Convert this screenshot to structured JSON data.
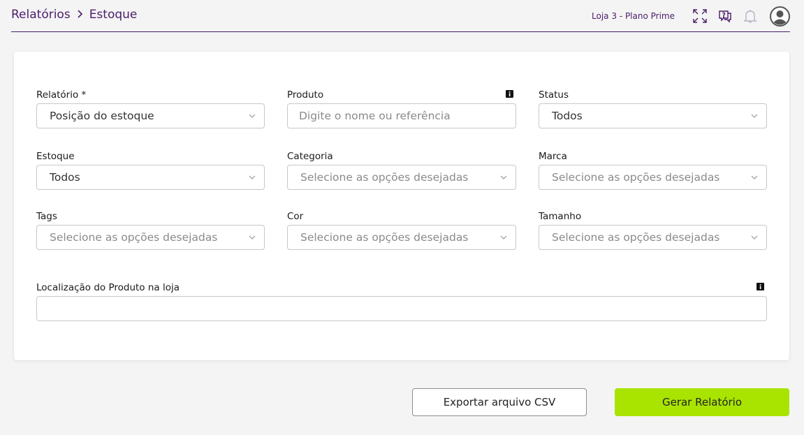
{
  "header": {
    "breadcrumb": [
      "Relatórios",
      "Estoque"
    ],
    "store_label": "Loja 3 - Plano Prime",
    "icons": [
      "expand-icon",
      "help-chat-icon",
      "bell-icon",
      "user-avatar"
    ]
  },
  "form": {
    "relatorio": {
      "label": "Relatório *",
      "value": "Posição do estoque"
    },
    "produto": {
      "label": "Produto",
      "placeholder": "Digite o nome ou referência"
    },
    "status": {
      "label": "Status",
      "value": "Todos"
    },
    "estoque": {
      "label": "Estoque",
      "value": "Todos"
    },
    "categoria": {
      "label": "Categoria",
      "placeholder": "Selecione as opções desejadas"
    },
    "marca": {
      "label": "Marca",
      "placeholder": "Selecione as opções desejadas"
    },
    "tags": {
      "label": "Tags",
      "placeholder": "Selecione as opções desejadas"
    },
    "cor": {
      "label": "Cor",
      "placeholder": "Selecione as opções desejadas"
    },
    "tamanho": {
      "label": "Tamanho",
      "placeholder": "Selecione as opções desejadas"
    },
    "localizacao": {
      "label": "Localização do Produto na loja",
      "value": ""
    }
  },
  "actions": {
    "export_label": "Exportar arquivo CSV",
    "generate_label": "Gerar Relatório"
  },
  "colors": {
    "brand": "#4a1d6b",
    "primary_button": "#a9e400",
    "background": "#f4f4f4"
  }
}
